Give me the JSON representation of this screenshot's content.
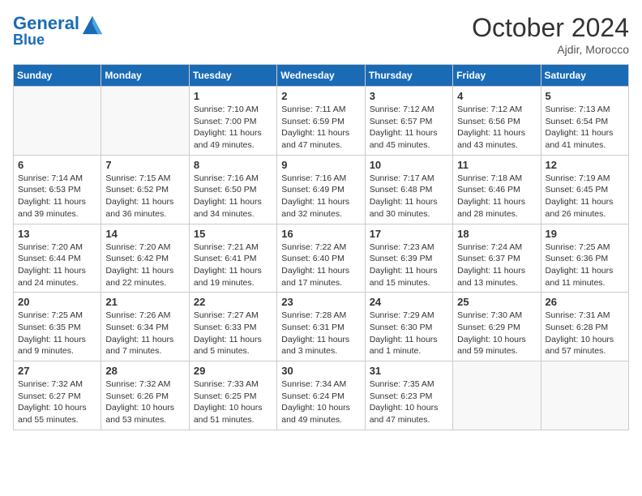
{
  "header": {
    "logo_line1": "General",
    "logo_line2": "Blue",
    "month": "October 2024",
    "location": "Ajdir, Morocco"
  },
  "weekdays": [
    "Sunday",
    "Monday",
    "Tuesday",
    "Wednesday",
    "Thursday",
    "Friday",
    "Saturday"
  ],
  "weeks": [
    [
      {
        "day": "",
        "info": ""
      },
      {
        "day": "",
        "info": ""
      },
      {
        "day": "1",
        "info": "Sunrise: 7:10 AM\nSunset: 7:00 PM\nDaylight: 11 hours and 49 minutes."
      },
      {
        "day": "2",
        "info": "Sunrise: 7:11 AM\nSunset: 6:59 PM\nDaylight: 11 hours and 47 minutes."
      },
      {
        "day": "3",
        "info": "Sunrise: 7:12 AM\nSunset: 6:57 PM\nDaylight: 11 hours and 45 minutes."
      },
      {
        "day": "4",
        "info": "Sunrise: 7:12 AM\nSunset: 6:56 PM\nDaylight: 11 hours and 43 minutes."
      },
      {
        "day": "5",
        "info": "Sunrise: 7:13 AM\nSunset: 6:54 PM\nDaylight: 11 hours and 41 minutes."
      }
    ],
    [
      {
        "day": "6",
        "info": "Sunrise: 7:14 AM\nSunset: 6:53 PM\nDaylight: 11 hours and 39 minutes."
      },
      {
        "day": "7",
        "info": "Sunrise: 7:15 AM\nSunset: 6:52 PM\nDaylight: 11 hours and 36 minutes."
      },
      {
        "day": "8",
        "info": "Sunrise: 7:16 AM\nSunset: 6:50 PM\nDaylight: 11 hours and 34 minutes."
      },
      {
        "day": "9",
        "info": "Sunrise: 7:16 AM\nSunset: 6:49 PM\nDaylight: 11 hours and 32 minutes."
      },
      {
        "day": "10",
        "info": "Sunrise: 7:17 AM\nSunset: 6:48 PM\nDaylight: 11 hours and 30 minutes."
      },
      {
        "day": "11",
        "info": "Sunrise: 7:18 AM\nSunset: 6:46 PM\nDaylight: 11 hours and 28 minutes."
      },
      {
        "day": "12",
        "info": "Sunrise: 7:19 AM\nSunset: 6:45 PM\nDaylight: 11 hours and 26 minutes."
      }
    ],
    [
      {
        "day": "13",
        "info": "Sunrise: 7:20 AM\nSunset: 6:44 PM\nDaylight: 11 hours and 24 minutes."
      },
      {
        "day": "14",
        "info": "Sunrise: 7:20 AM\nSunset: 6:42 PM\nDaylight: 11 hours and 22 minutes."
      },
      {
        "day": "15",
        "info": "Sunrise: 7:21 AM\nSunset: 6:41 PM\nDaylight: 11 hours and 19 minutes."
      },
      {
        "day": "16",
        "info": "Sunrise: 7:22 AM\nSunset: 6:40 PM\nDaylight: 11 hours and 17 minutes."
      },
      {
        "day": "17",
        "info": "Sunrise: 7:23 AM\nSunset: 6:39 PM\nDaylight: 11 hours and 15 minutes."
      },
      {
        "day": "18",
        "info": "Sunrise: 7:24 AM\nSunset: 6:37 PM\nDaylight: 11 hours and 13 minutes."
      },
      {
        "day": "19",
        "info": "Sunrise: 7:25 AM\nSunset: 6:36 PM\nDaylight: 11 hours and 11 minutes."
      }
    ],
    [
      {
        "day": "20",
        "info": "Sunrise: 7:25 AM\nSunset: 6:35 PM\nDaylight: 11 hours and 9 minutes."
      },
      {
        "day": "21",
        "info": "Sunrise: 7:26 AM\nSunset: 6:34 PM\nDaylight: 11 hours and 7 minutes."
      },
      {
        "day": "22",
        "info": "Sunrise: 7:27 AM\nSunset: 6:33 PM\nDaylight: 11 hours and 5 minutes."
      },
      {
        "day": "23",
        "info": "Sunrise: 7:28 AM\nSunset: 6:31 PM\nDaylight: 11 hours and 3 minutes."
      },
      {
        "day": "24",
        "info": "Sunrise: 7:29 AM\nSunset: 6:30 PM\nDaylight: 11 hours and 1 minute."
      },
      {
        "day": "25",
        "info": "Sunrise: 7:30 AM\nSunset: 6:29 PM\nDaylight: 10 hours and 59 minutes."
      },
      {
        "day": "26",
        "info": "Sunrise: 7:31 AM\nSunset: 6:28 PM\nDaylight: 10 hours and 57 minutes."
      }
    ],
    [
      {
        "day": "27",
        "info": "Sunrise: 7:32 AM\nSunset: 6:27 PM\nDaylight: 10 hours and 55 minutes."
      },
      {
        "day": "28",
        "info": "Sunrise: 7:32 AM\nSunset: 6:26 PM\nDaylight: 10 hours and 53 minutes."
      },
      {
        "day": "29",
        "info": "Sunrise: 7:33 AM\nSunset: 6:25 PM\nDaylight: 10 hours and 51 minutes."
      },
      {
        "day": "30",
        "info": "Sunrise: 7:34 AM\nSunset: 6:24 PM\nDaylight: 10 hours and 49 minutes."
      },
      {
        "day": "31",
        "info": "Sunrise: 7:35 AM\nSunset: 6:23 PM\nDaylight: 10 hours and 47 minutes."
      },
      {
        "day": "",
        "info": ""
      },
      {
        "day": "",
        "info": ""
      }
    ]
  ]
}
